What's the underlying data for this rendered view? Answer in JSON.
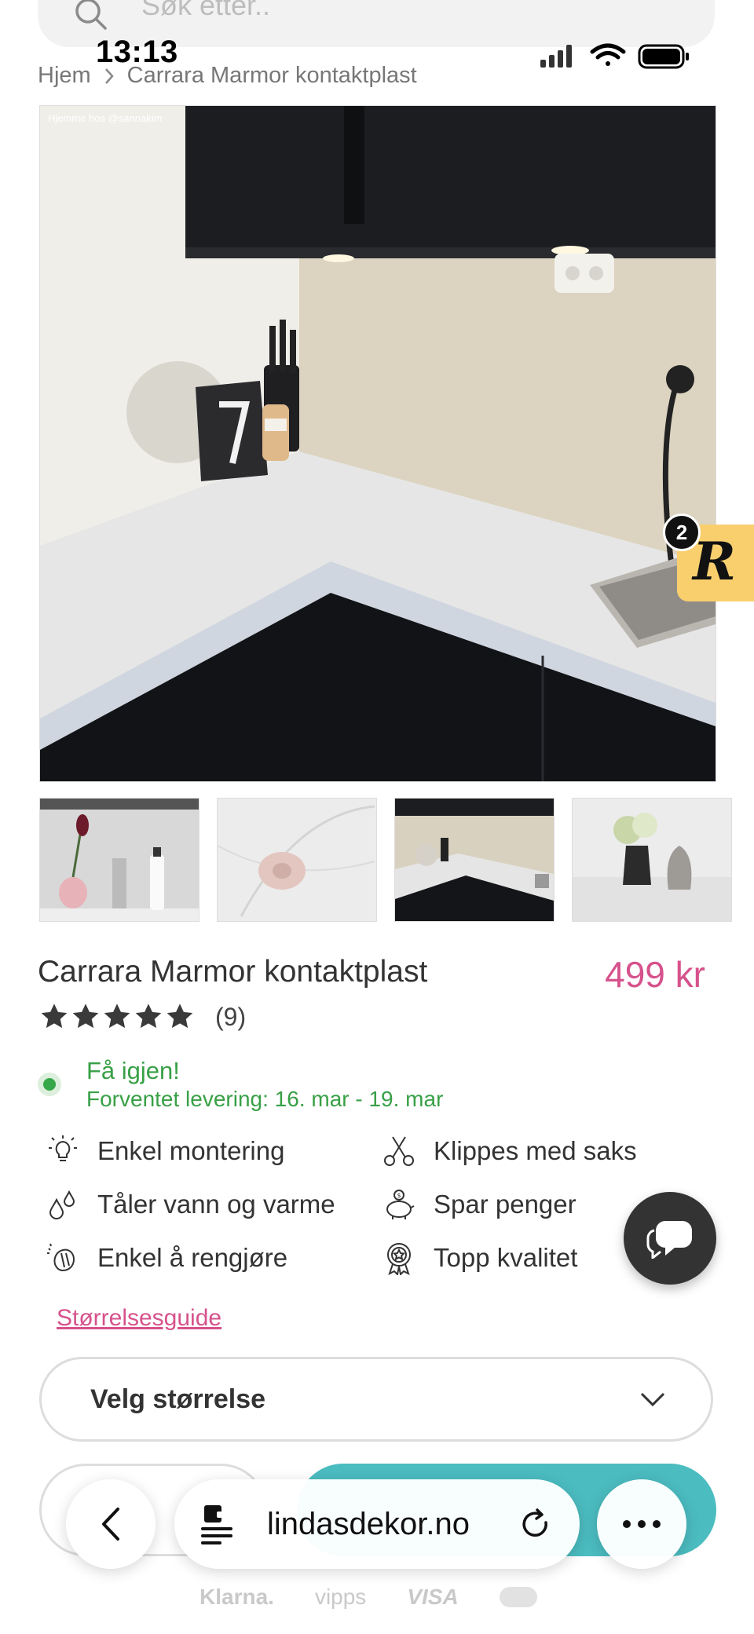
{
  "search": {
    "placeholder": "Søk etter.."
  },
  "status_bar": {
    "time": "13:13"
  },
  "breadcrumb": {
    "home": "Hjem",
    "current": "Carrara Marmor kontaktplast"
  },
  "hero": {
    "watermark": "Hjemme hos @sannakim"
  },
  "rewards_badge": {
    "count": "2",
    "letter": "R",
    "color": "#f9cf6e"
  },
  "product": {
    "title": "Carrara Marmor kontaktplast",
    "price": "499 kr",
    "rating_stars": 5,
    "review_count": "(9)",
    "stock_status": "Få igjen!",
    "delivery": "Forventet levering: 16. mar - 19. mar",
    "features": [
      {
        "icon": "lightbulb-icon",
        "label": "Enkel montering"
      },
      {
        "icon": "scissors-icon",
        "label": "Klippes med saks"
      },
      {
        "icon": "water-drops-icon",
        "label": "Tåler vann og varme"
      },
      {
        "icon": "piggy-bank-icon",
        "label": "Spar penger"
      },
      {
        "icon": "clean-hand-icon",
        "label": "Enkel å rengjøre"
      },
      {
        "icon": "quality-badge-icon",
        "label": "Topp kvalitet"
      }
    ],
    "size_guide": "Størrelsesguide",
    "size_select": "Velg størrelse"
  },
  "browser": {
    "host": "lindasdekor.no"
  },
  "payments": [
    "Klarna.",
    "vipps",
    "VISA"
  ],
  "colors": {
    "accent_pink": "#d6528c",
    "stock_green": "#38a046",
    "cart_teal": "#4bbcc0"
  }
}
